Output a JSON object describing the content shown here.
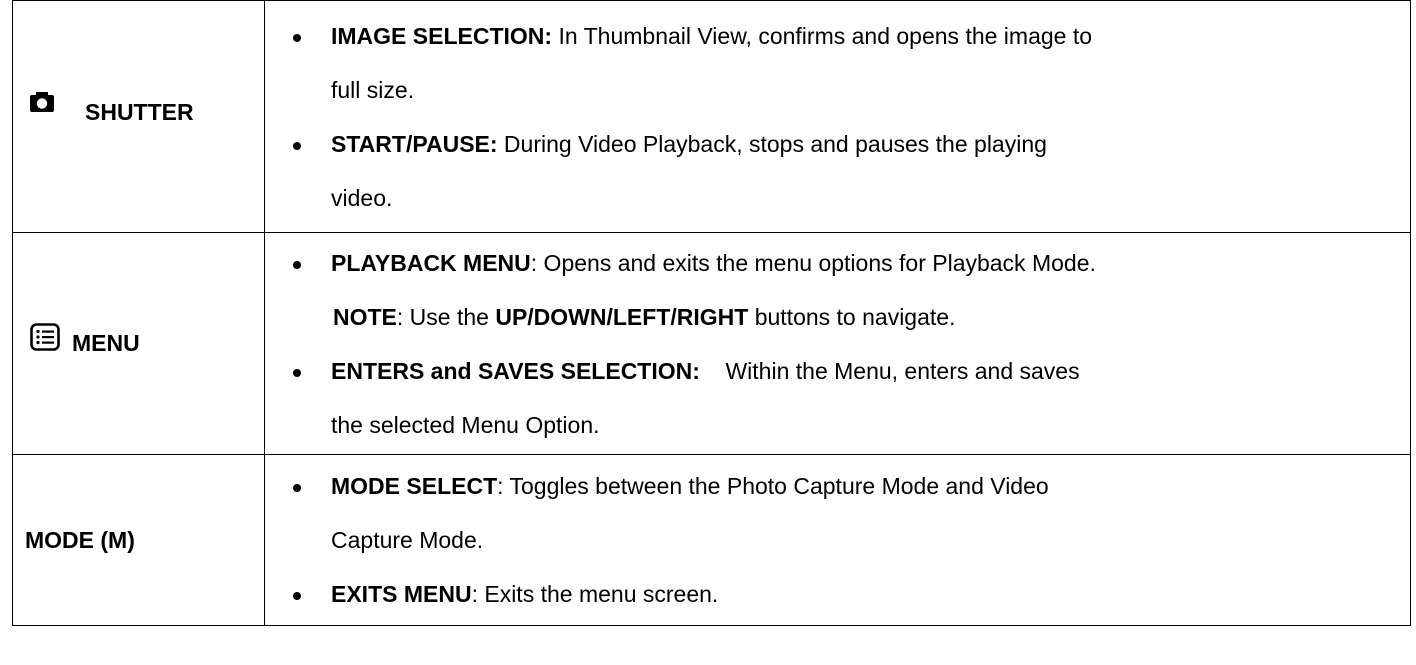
{
  "rows": [
    {
      "label": "SHUTTER",
      "icon": "camera-icon",
      "items": [
        {
          "title": "IMAGE SELECTION:",
          "text": " In Thumbnail View, confirms and opens the image to",
          "cont": "full size."
        },
        {
          "title": "START/PAUSE:",
          "text": " During Video Playback, stops and pauses the playing",
          "cont": "video."
        }
      ]
    },
    {
      "label": "MENU",
      "icon": "menu-list-icon",
      "items": [
        {
          "title": "PLAYBACK MENU",
          "text": ": Opens and exits the menu options for Playback Mode.",
          "note": {
            "title": "NOTE",
            "text1": ": Use the ",
            "bold": "UP/DOWN/LEFT/RIGHT",
            "text2": " buttons to navigate."
          }
        },
        {
          "title": "ENTERS and SAVES SELECTION:",
          "text": "    Within the Menu, enters and saves",
          "cont": "the selected Menu Option."
        }
      ]
    },
    {
      "label": "MODE (M)",
      "items": [
        {
          "title": "MODE SELECT",
          "text": ": Toggles between the Photo Capture Mode and Video",
          "cont": "Capture Mode."
        },
        {
          "title": "EXITS MENU",
          "text": ": Exits the menu screen."
        }
      ]
    }
  ]
}
